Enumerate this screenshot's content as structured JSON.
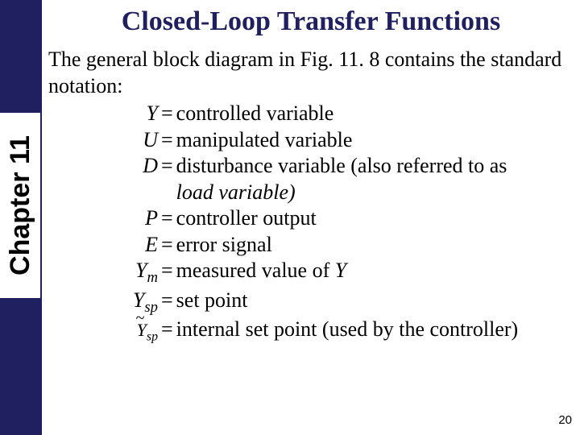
{
  "sidebar": {
    "chapter_label": "Chapter 11"
  },
  "title": "Closed-Loop Transfer Functions",
  "intro": "The general block diagram in Fig. 11. 8 contains the standard notation:",
  "defs": {
    "r0": {
      "sym": "Y",
      "eq": "=",
      "desc": "controlled variable"
    },
    "r1": {
      "sym": "U",
      "eq": "=",
      "desc": "manipulated variable"
    },
    "r2": {
      "sym": "D",
      "eq": "=",
      "desc_a": "disturbance variable (also referred to as ",
      "desc_b": "load variable)"
    },
    "r3": {
      "sym": "P",
      "eq": "=",
      "desc": "controller output"
    },
    "r4": {
      "sym": "E",
      "eq": "=",
      "desc": "error signal"
    },
    "r5": {
      "sym_base": "Y",
      "sym_sub": "m",
      "eq": "=",
      "desc_a": "measured value of ",
      "desc_b": "Y"
    },
    "r6": {
      "sym_base": "Y",
      "sym_sub": "sp",
      "eq": "=",
      "desc": "set point"
    },
    "r7": {
      "sym_base": "Y",
      "sym_sub": "sp",
      "eq": "=",
      "desc": "internal set point (used by the controller)"
    }
  },
  "page_number": "20"
}
